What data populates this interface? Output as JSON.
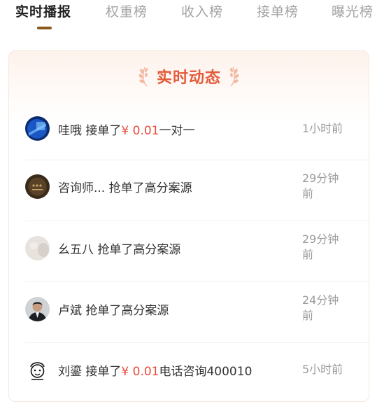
{
  "tabs": [
    {
      "label": "实时播报",
      "active": true
    },
    {
      "label": "权重榜",
      "active": false
    },
    {
      "label": "收入榜",
      "active": false
    },
    {
      "label": "接单榜",
      "active": false
    },
    {
      "label": "曝光榜",
      "active": false
    }
  ],
  "colors": {
    "accent": "#e35b3a",
    "price": "#e74b3c",
    "tab_underline": "#8c5a1e",
    "muted": "#9b9b9b"
  },
  "card": {
    "title": "实时动态"
  },
  "feed": [
    {
      "name": "哇哦",
      "action": "接单了",
      "price": "¥ 0.01",
      "service": "一对一",
      "time": "1小时前"
    },
    {
      "name": "咨询师...",
      "action": "抢单了高分案源",
      "price": "",
      "service": "",
      "time": "29分钟\n前"
    },
    {
      "name": "幺五八",
      "action": "抢单了高分案源",
      "price": "",
      "service": "",
      "time": "29分钟\n前"
    },
    {
      "name": "卢斌",
      "action": "抢单了高分案源",
      "price": "",
      "service": "",
      "time": "24分钟\n前"
    },
    {
      "name": "刘鎏",
      "action": "接单了",
      "price": "¥ 0.01",
      "service": "电话咨询400010",
      "time": "5小时前"
    }
  ]
}
